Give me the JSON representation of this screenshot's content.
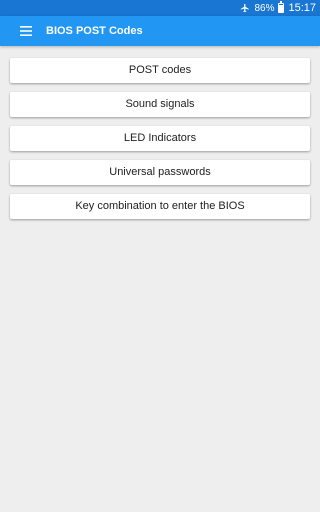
{
  "status_bar": {
    "battery": "86%",
    "time": "15:17",
    "icons": [
      "airplane-icon",
      "battery-icon"
    ],
    "battery_level": 0.86,
    "battery_color": "#ffffff"
  },
  "toolbar": {
    "title": "BIOS POST Codes",
    "menu_icon": "menu-icon",
    "bg_color": "#2196f3"
  },
  "menu": {
    "items": [
      {
        "label": "POST codes"
      },
      {
        "label": "Sound signals"
      },
      {
        "label": "LED Indicators"
      },
      {
        "label": "Universal passwords"
      },
      {
        "label": "Key combination to enter the BIOS"
      }
    ]
  }
}
